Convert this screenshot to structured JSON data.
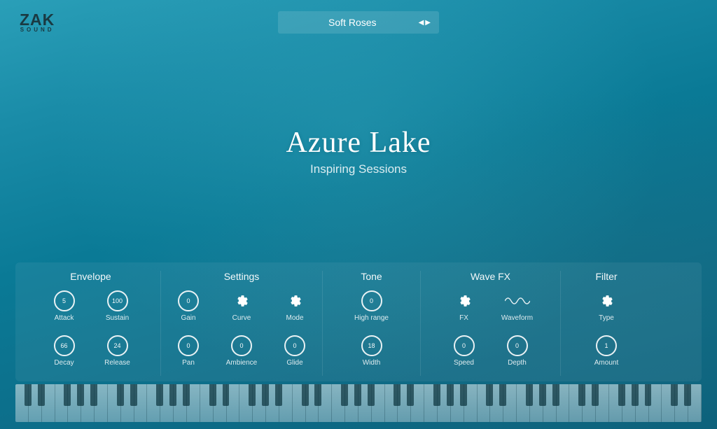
{
  "brand": {
    "main": "ZAK",
    "sub": "SOUND"
  },
  "preset": {
    "name": "Soft Roses"
  },
  "title": {
    "main": "Azure Lake",
    "sub": "Inspiring Sessions"
  },
  "sections": {
    "envelope": {
      "title": "Envelope",
      "attack": {
        "label": "Attack",
        "value": "5"
      },
      "sustain": {
        "label": "Sustain",
        "value": "100"
      },
      "decay": {
        "label": "Decay",
        "value": "66"
      },
      "release": {
        "label": "Release",
        "value": "24"
      }
    },
    "settings": {
      "title": "Settings",
      "gain": {
        "label": "Gain",
        "value": "0"
      },
      "curve": {
        "label": "Curve"
      },
      "mode": {
        "label": "Mode"
      },
      "pan": {
        "label": "Pan",
        "value": "0"
      },
      "ambience": {
        "label": "Ambience",
        "value": "0"
      },
      "glide": {
        "label": "Glide",
        "value": "0"
      }
    },
    "tone": {
      "title": "Tone",
      "highrange": {
        "label": "High range",
        "value": "0"
      },
      "width": {
        "label": "Width",
        "value": "18"
      }
    },
    "wavefx": {
      "title": "Wave FX",
      "fx": {
        "label": "FX"
      },
      "waveform": {
        "label": "Waveform"
      },
      "speed": {
        "label": "Speed",
        "value": "0"
      },
      "depth": {
        "label": "Depth",
        "value": "0"
      }
    },
    "filter": {
      "title": "Filter",
      "type": {
        "label": "Type"
      },
      "amount": {
        "label": "Amount",
        "value": "1"
      }
    }
  }
}
